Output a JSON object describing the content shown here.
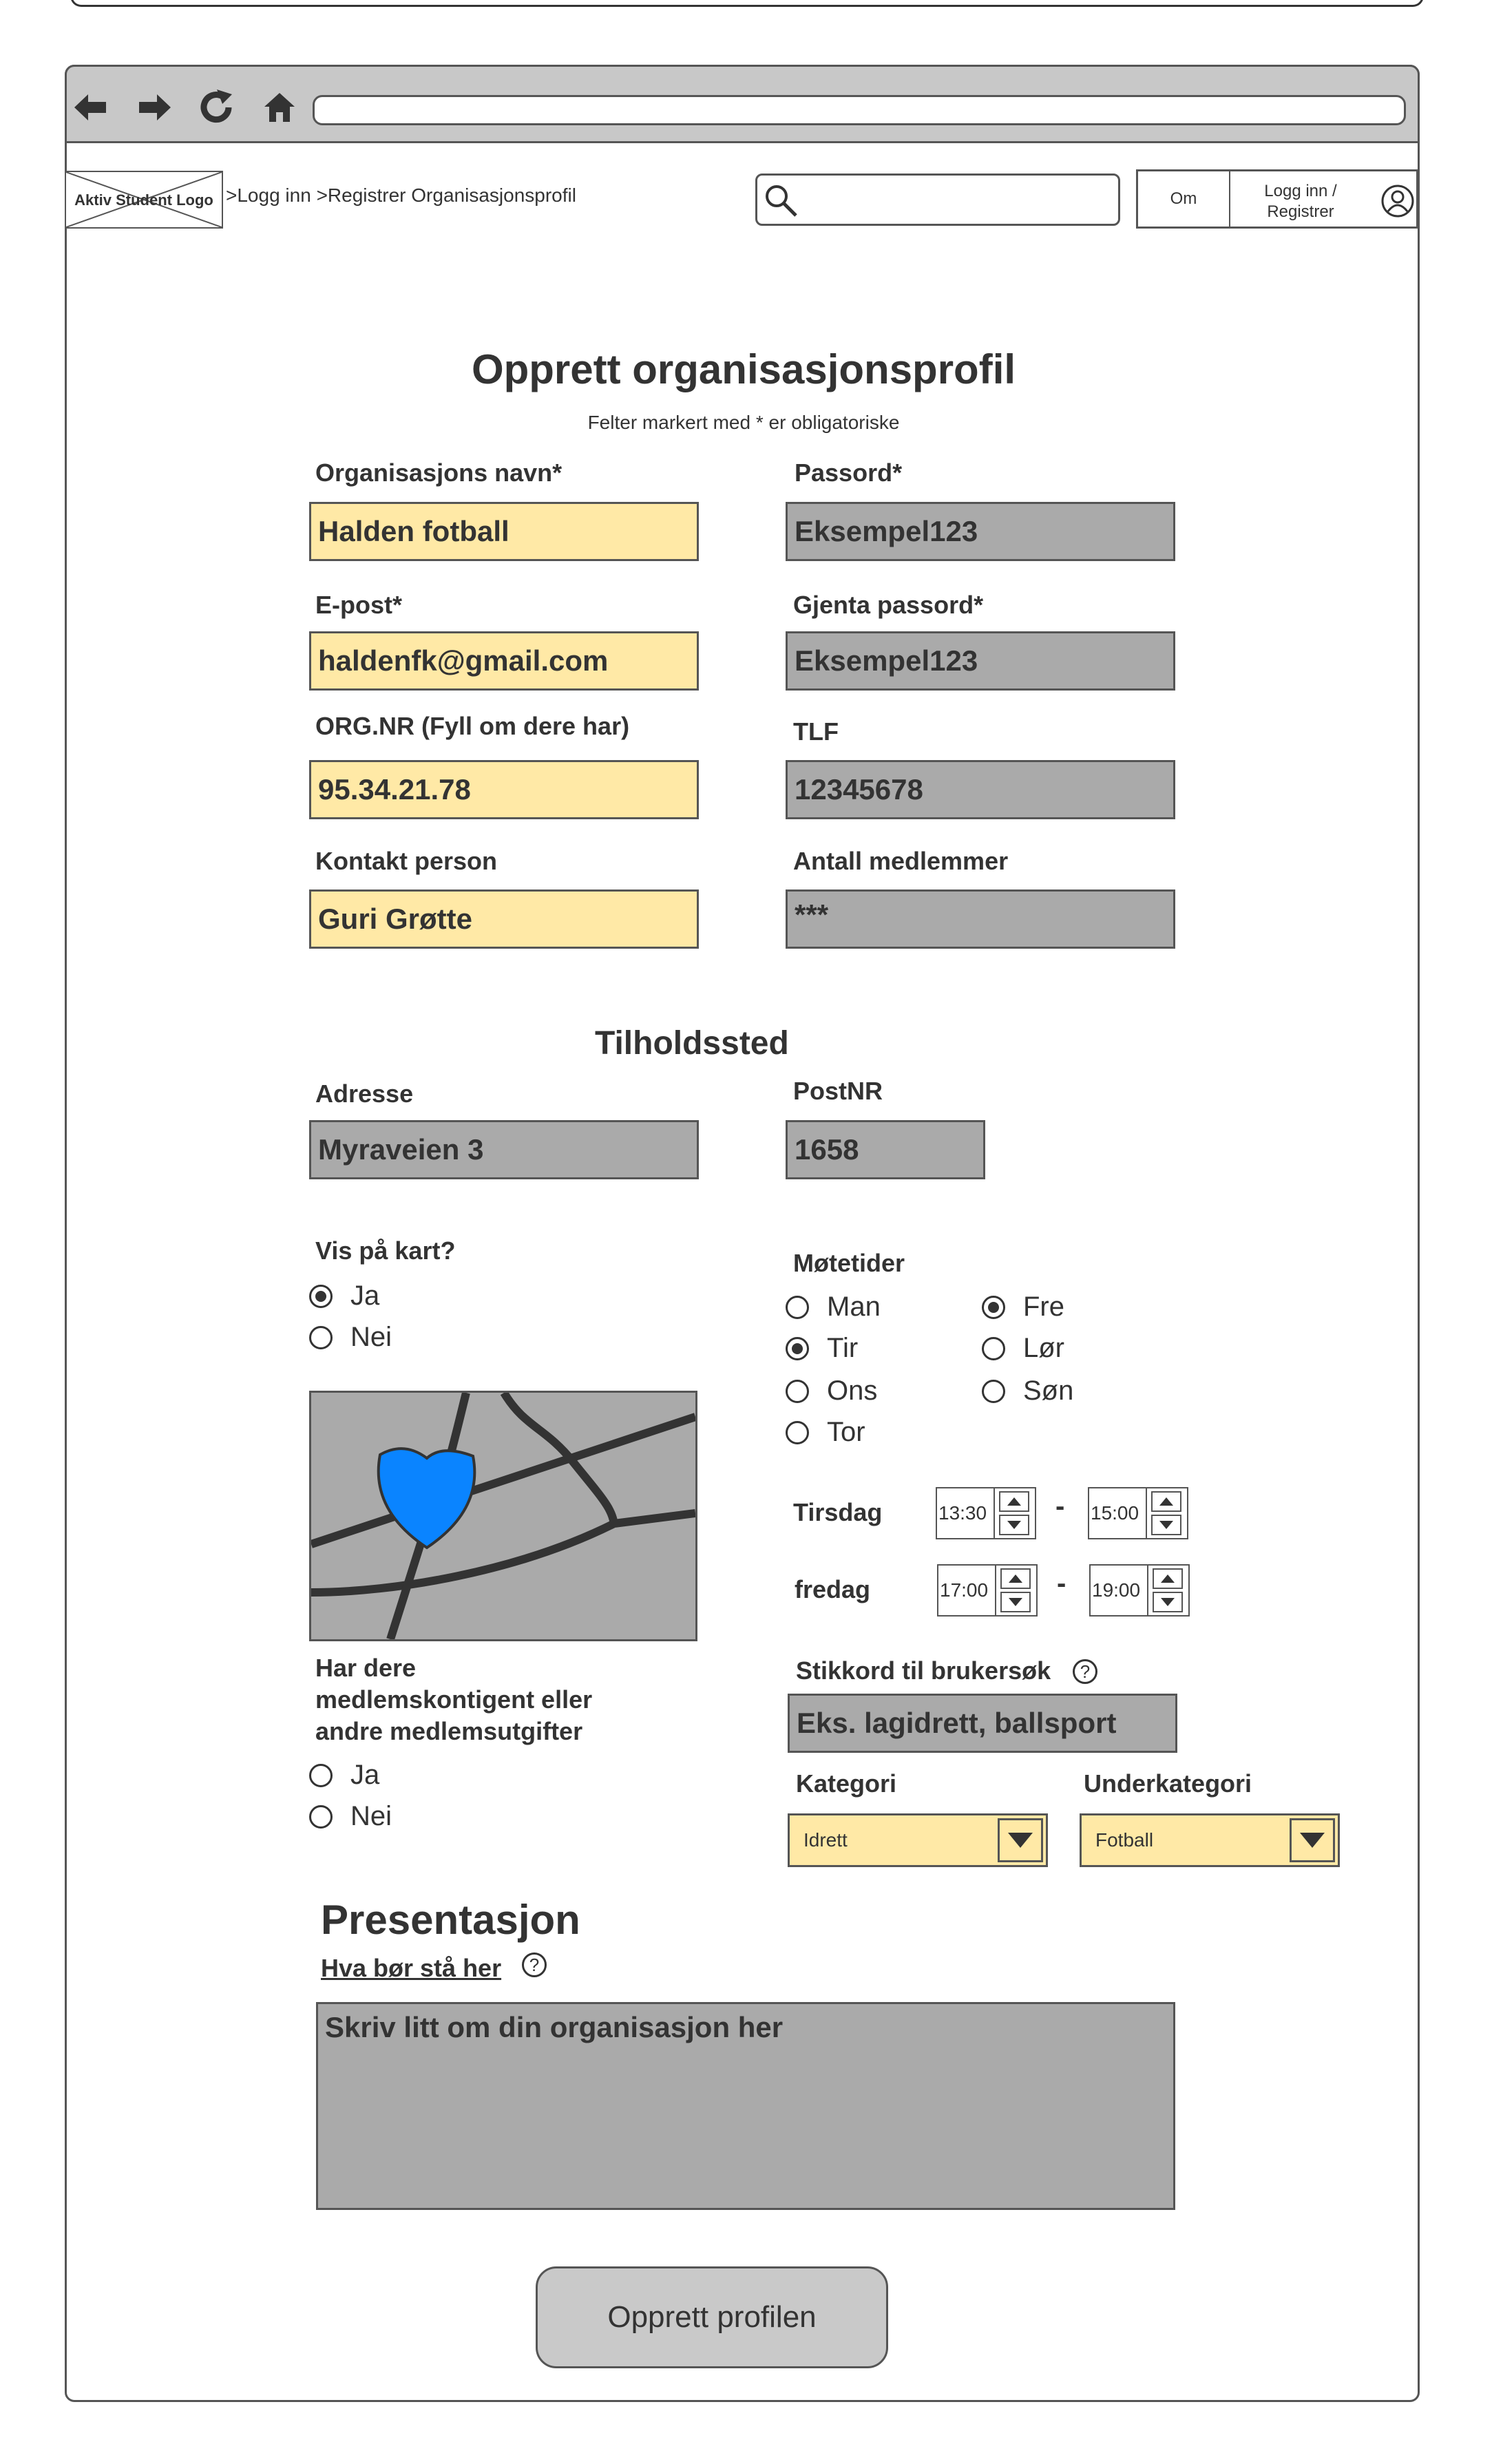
{
  "browser": {
    "url": ""
  },
  "header": {
    "logo_text": "Aktiv Student Logo",
    "breadcrumb": ">Logg inn >Registrer Organisasjonsprofil",
    "search_placeholder": "",
    "nav_about": "Om",
    "nav_login": "Logg inn / Registrer"
  },
  "page": {
    "title": "Opprett organisasjonsprofil",
    "subtitle": "Felter markert med * er obligatoriske"
  },
  "form": {
    "org_name": {
      "label": "Organisasjons navn*",
      "value": "Halden fotball"
    },
    "password": {
      "label": "Passord*",
      "value": "Eksempel123"
    },
    "email": {
      "label": "E-post*",
      "value": "haldenfk@gmail.com"
    },
    "password_repeat": {
      "label": "Gjenta passord*",
      "value": "Eksempel123"
    },
    "org_nr": {
      "label": "ORG.NR (Fyll om dere har)",
      "value": "95.34.21.78"
    },
    "phone": {
      "label": "TLF",
      "value": "12345678"
    },
    "contact": {
      "label": "Kontakt person",
      "value": "Guri Grøtte"
    },
    "members": {
      "label": "Antall medlemmer",
      "value": "***"
    }
  },
  "location": {
    "heading": "Tilholdssted",
    "address": {
      "label": "Adresse",
      "value": "Myraveien 3"
    },
    "postnr": {
      "label": "PostNR",
      "value": "1658"
    },
    "show_map": {
      "label": "Vis på kart?",
      "yes": "Ja",
      "no": "Nei",
      "selected": "Ja"
    }
  },
  "meetings": {
    "label": "Møtetider",
    "days": [
      {
        "name": "Man",
        "checked": false
      },
      {
        "name": "Tir",
        "checked": true
      },
      {
        "name": "Ons",
        "checked": false
      },
      {
        "name": "Tor",
        "checked": false
      },
      {
        "name": "Fre",
        "checked": true
      },
      {
        "name": "Lør",
        "checked": false
      },
      {
        "name": "Søn",
        "checked": false
      }
    ],
    "times": [
      {
        "day": "Tirsdag",
        "from": "13:30",
        "to": "15:00"
      },
      {
        "day": "fredag",
        "from": "17:00",
        "to": "19:00"
      }
    ],
    "separator": "-"
  },
  "fees": {
    "label": "Har dere medlemskontigent eller andre medlemsutgifter",
    "yes": "Ja",
    "no": "Nei"
  },
  "keywords": {
    "label": "Stikkord til brukersøk",
    "placeholder": "Eks. lagidrett, ballsport"
  },
  "category": {
    "label": "Kategori",
    "value": "Idrett"
  },
  "subcategory": {
    "label": "Underkategori",
    "value": "Fotball"
  },
  "presentation": {
    "heading": "Presentasjon",
    "help_link": "Hva bør stå her",
    "placeholder": "Skriv litt om din organisasjon her"
  },
  "submit_label": "Opprett profilen",
  "colors": {
    "input_yellow": "#ffe9a6",
    "input_gray": "#aaaaaa",
    "map_marker": "#0a84ff"
  }
}
